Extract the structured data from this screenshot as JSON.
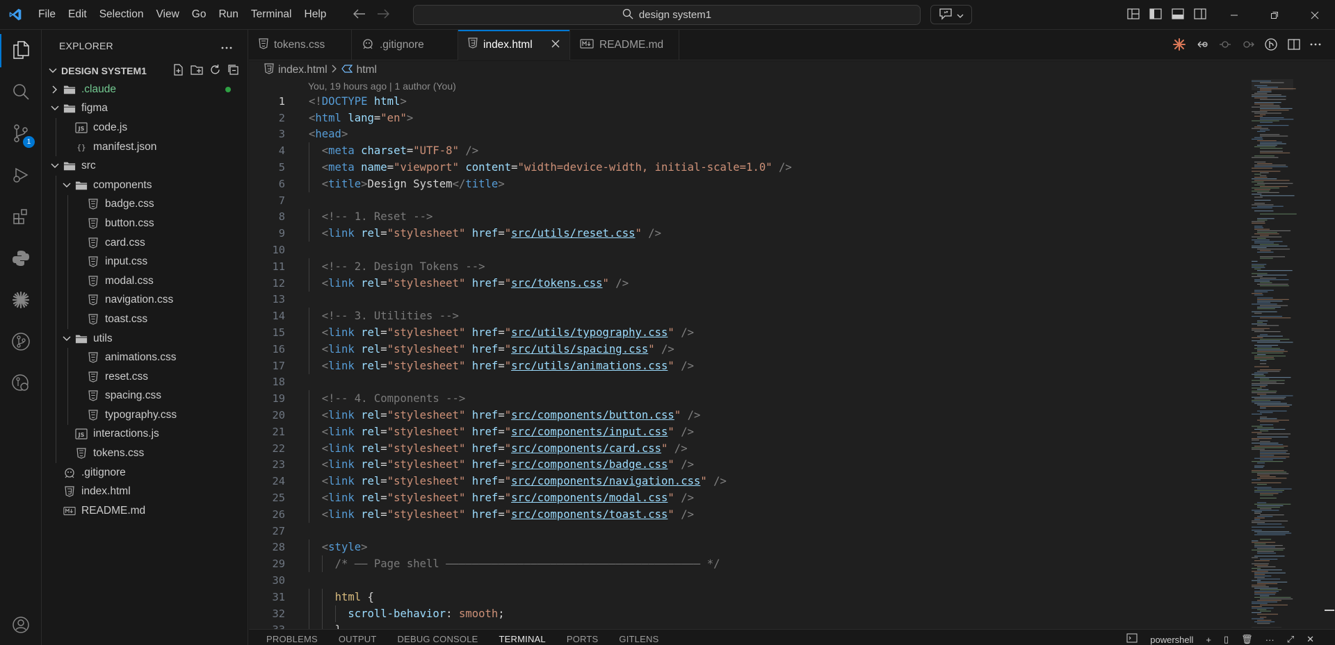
{
  "titlebar": {
    "menu": [
      "File",
      "Edit",
      "Selection",
      "View",
      "Go",
      "Run",
      "Terminal",
      "Help"
    ],
    "search_text": "design system1"
  },
  "activity": {
    "scm_badge": "1"
  },
  "sidebar": {
    "title": "EXPLORER",
    "folder_name": "DESIGN SYSTEM1",
    "items": [
      {
        "label": ".claude",
        "depth": 0,
        "type": "folder",
        "open": false,
        "color": "#73c991"
      },
      {
        "label": "figma",
        "depth": 0,
        "type": "folder",
        "open": true
      },
      {
        "label": "code.js",
        "depth": 1,
        "type": "js"
      },
      {
        "label": "manifest.json",
        "depth": 1,
        "type": "json"
      },
      {
        "label": "src",
        "depth": 0,
        "type": "folder",
        "open": true
      },
      {
        "label": "components",
        "depth": 1,
        "type": "folder",
        "open": true
      },
      {
        "label": "badge.css",
        "depth": 2,
        "type": "css"
      },
      {
        "label": "button.css",
        "depth": 2,
        "type": "css"
      },
      {
        "label": "card.css",
        "depth": 2,
        "type": "css"
      },
      {
        "label": "input.css",
        "depth": 2,
        "type": "css"
      },
      {
        "label": "modal.css",
        "depth": 2,
        "type": "css"
      },
      {
        "label": "navigation.css",
        "depth": 2,
        "type": "css"
      },
      {
        "label": "toast.css",
        "depth": 2,
        "type": "css"
      },
      {
        "label": "utils",
        "depth": 1,
        "type": "folder",
        "open": true
      },
      {
        "label": "animations.css",
        "depth": 2,
        "type": "css"
      },
      {
        "label": "reset.css",
        "depth": 2,
        "type": "css"
      },
      {
        "label": "spacing.css",
        "depth": 2,
        "type": "css"
      },
      {
        "label": "typography.css",
        "depth": 2,
        "type": "css"
      },
      {
        "label": "interactions.js",
        "depth": 1,
        "type": "js"
      },
      {
        "label": "tokens.css",
        "depth": 1,
        "type": "css"
      },
      {
        "label": ".gitignore",
        "depth": 0,
        "type": "git"
      },
      {
        "label": "index.html",
        "depth": 0,
        "type": "html"
      },
      {
        "label": "README.md",
        "depth": 0,
        "type": "md"
      }
    ]
  },
  "tabs": [
    {
      "label": "tokens.css",
      "type": "css",
      "active": false
    },
    {
      "label": ".gitignore",
      "type": "git",
      "active": false
    },
    {
      "label": "index.html",
      "type": "html",
      "active": true
    },
    {
      "label": "README.md",
      "type": "md",
      "active": false
    }
  ],
  "breadcrumb": {
    "file": "index.html",
    "symbol": "html"
  },
  "editor": {
    "blame": "You, 19 hours ago | 1 author (You)",
    "current_line": 1,
    "lines": [
      "<!DOCTYPE html>",
      "<html lang=\"en\">",
      "<head>",
      "  <meta charset=\"UTF-8\" />",
      "  <meta name=\"viewport\" content=\"width=device-width, initial-scale=1.0\" />",
      "  <title>Design System</title>",
      "",
      "  <!-- 1. Reset -->",
      "  <link rel=\"stylesheet\" href=\"src/utils/reset.css\" />",
      "",
      "  <!-- 2. Design Tokens -->",
      "  <link rel=\"stylesheet\" href=\"src/tokens.css\" />",
      "",
      "  <!-- 3. Utilities -->",
      "  <link rel=\"stylesheet\" href=\"src/utils/typography.css\" />",
      "  <link rel=\"stylesheet\" href=\"src/utils/spacing.css\" />",
      "  <link rel=\"stylesheet\" href=\"src/utils/animations.css\" />",
      "",
      "  <!-- 4. Components -->",
      "  <link rel=\"stylesheet\" href=\"src/components/button.css\" />",
      "  <link rel=\"stylesheet\" href=\"src/components/input.css\" />",
      "  <link rel=\"stylesheet\" href=\"src/components/card.css\" />",
      "  <link rel=\"stylesheet\" href=\"src/components/badge.css\" />",
      "  <link rel=\"stylesheet\" href=\"src/components/navigation.css\" />",
      "  <link rel=\"stylesheet\" href=\"src/components/modal.css\" />",
      "  <link rel=\"stylesheet\" href=\"src/components/toast.css\" />",
      "",
      "  <style>",
      "    /* —— Page shell ——————————————————————————————————————— */",
      "",
      "    html {",
      "      scroll-behavior: smooth;",
      "    }"
    ]
  },
  "panel": {
    "tabs": [
      "PROBLEMS",
      "OUTPUT",
      "DEBUG CONSOLE",
      "TERMINAL",
      "PORTS",
      "GITLENS"
    ],
    "active_tab": "TERMINAL",
    "terminal_name": "powershell"
  },
  "colors": {
    "accent": "#0078d4",
    "background": "#1f1f1f",
    "sidebar": "#181818"
  }
}
